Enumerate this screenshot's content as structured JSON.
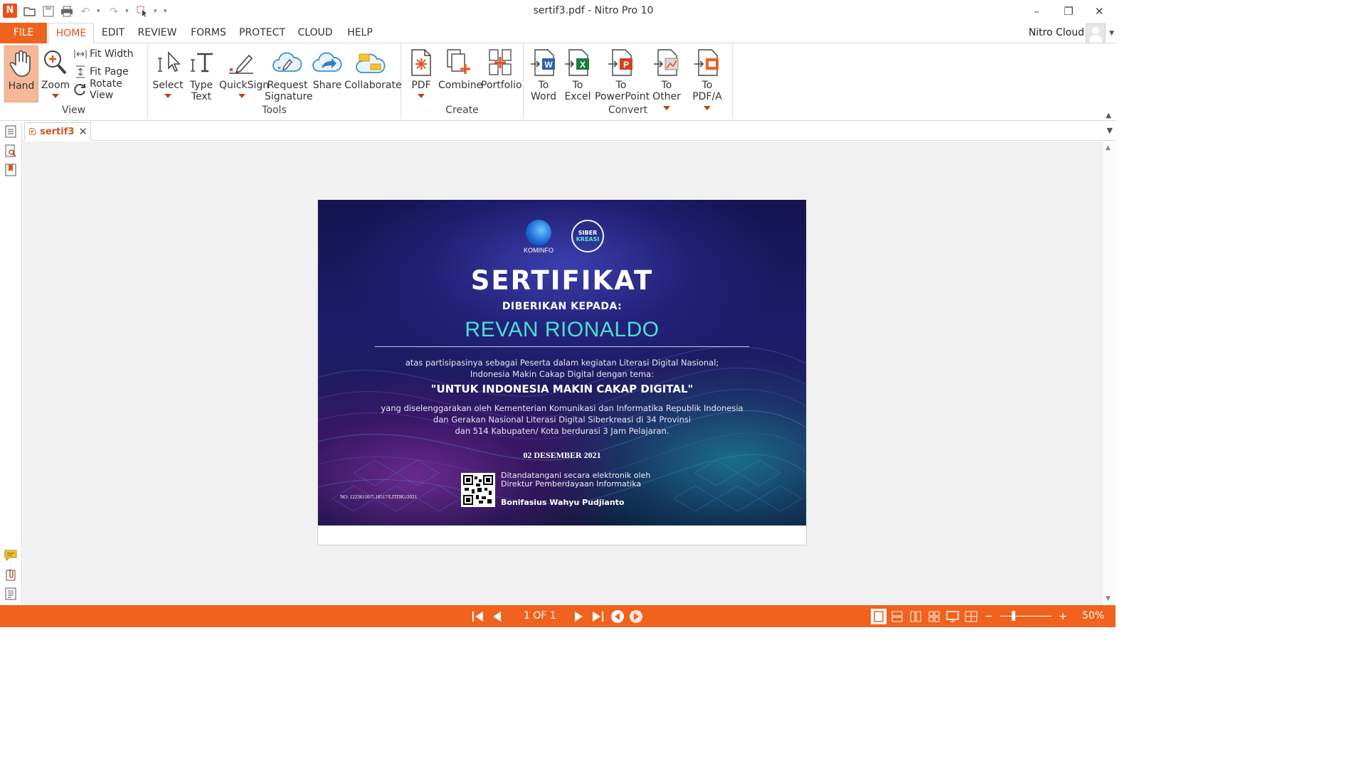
{
  "window": {
    "title": "sertif3.pdf - Nitro Pro 10",
    "app_logo": "N"
  },
  "ribbon_tabs": [
    "FILE",
    "HOME",
    "EDIT",
    "REVIEW",
    "FORMS",
    "PROTECT",
    "CLOUD",
    "HELP"
  ],
  "active_tab": "HOME",
  "account": {
    "label": "Nitro Cloud"
  },
  "ribbon": {
    "view": {
      "label": "View",
      "hand": "Hand",
      "zoom": "Zoom",
      "fit_width": "Fit Width",
      "fit_page": "Fit Page",
      "rotate_view": "Rotate View"
    },
    "tools": {
      "label": "Tools",
      "select": "Select",
      "type_text_1": "Type",
      "type_text_2": "Text",
      "quicksign": "QuickSign",
      "request_1": "Request",
      "request_2": "Signature",
      "share": "Share",
      "collaborate": "Collaborate"
    },
    "create": {
      "label": "Create",
      "pdf": "PDF",
      "combine": "Combine",
      "portfolio": "Portfolio"
    },
    "convert": {
      "label": "Convert",
      "to": "To",
      "word": "Word",
      "excel": "Excel",
      "powerpoint": "PowerPoint",
      "other": "Other",
      "pdfa": "PDF/A"
    }
  },
  "document_tab": {
    "name": "sertif3"
  },
  "certificate": {
    "kominfo_logo_text": "KOMINFO",
    "siber_logo_line1": "SIBER",
    "siber_logo_line2": "KREASI",
    "title": "SERTIFIKAT",
    "given_to": "DIBERIKAN KEPADA:",
    "recipient": "REVAN RIONALDO",
    "body_line1": "atas partisipasinya sebagai Peserta dalam kegiatan Literasi Digital Nasional;",
    "body_line2": "Indonesia Makin Cakap Digital dengan tema:",
    "theme": "\"UNTUK INDONESIA MAKIN CAKAP DIGITAL\"",
    "org_line1": "yang diselenggarakan oleh Kementerian Komunikasi dan Informatika Republik Indonesia",
    "org_line2": "dan Gerakan Nasional Literasi Digital Siberkreasi di 34 Provinsi",
    "org_line3": "dan 514 Kabupaten/ Kota berdurasi 3 Jam Pelajaran.",
    "date": "02 DESEMBER 2021",
    "signed_line1": "Ditandatangani secara elektronik oleh",
    "signed_line2": "Direktur Pemberdayaan Informatika",
    "signer": "Bonifasius Wahyu Pudjianto",
    "cert_number": "NO: 12236110/7-18517/LITDIG/2021"
  },
  "status": {
    "page_indicator": "1 OF 1",
    "zoom": "50%",
    "zoom_minus": "−",
    "zoom_plus": "+"
  },
  "colors": {
    "accent": "#f0621d",
    "name_teal": "#4be0cf"
  }
}
